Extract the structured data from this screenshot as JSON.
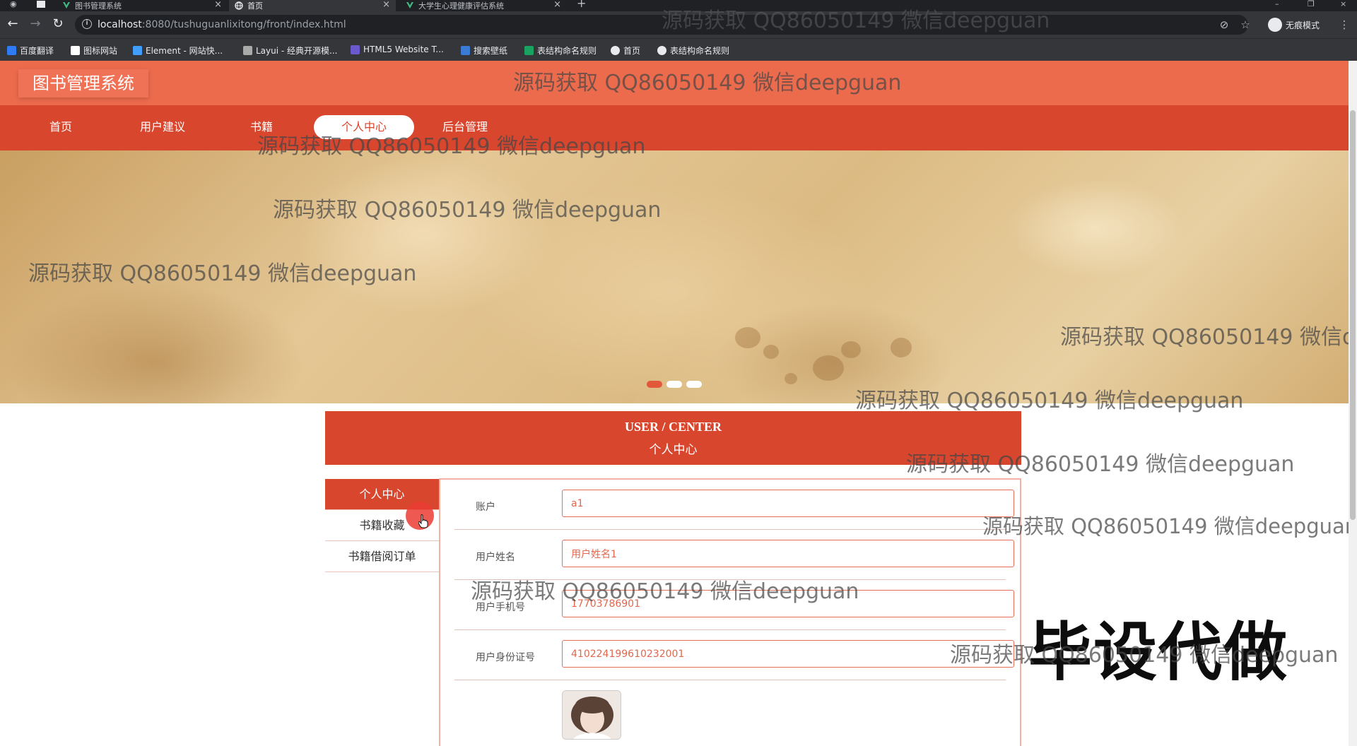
{
  "browser": {
    "tabs": [
      {
        "title": "图书管理系统",
        "icon": "vue-icon",
        "active": false
      },
      {
        "title": "首页",
        "icon": "globe-icon",
        "active": true
      },
      {
        "title": "大学生心理健康评估系统",
        "icon": "vue-icon",
        "active": false
      }
    ],
    "new_tab_label": "+",
    "url_host": "localhost",
    "url_rest": ":8080/tushuguanlixitong/front/index.html",
    "incognito_label": "无痕模式",
    "bookmarks": [
      {
        "label": "百度翻译",
        "icon": "translate-icon",
        "color": "#2f7bf5"
      },
      {
        "label": "图标网站",
        "icon": "flag-icon",
        "color": "#ffffff"
      },
      {
        "label": "Element - 网站快...",
        "icon": "element-icon",
        "color": "#409eff"
      },
      {
        "label": "Layui - 经典开源模...",
        "icon": "layui-icon",
        "color": "#aaaaaa"
      },
      {
        "label": "HTML5 Website T...",
        "icon": "html5-icon",
        "color": "#6a5acd"
      },
      {
        "label": "搜索壁纸",
        "icon": "wallpaper-icon",
        "color": "#3a7bd5"
      },
      {
        "label": "表结构命名规则",
        "icon": "sheet-icon",
        "color": "#1aa260"
      },
      {
        "label": "首页",
        "icon": "globe-icon",
        "color": "#e8eaed"
      },
      {
        "label": "表结构命名规则",
        "icon": "globe-icon",
        "color": "#e8eaed"
      }
    ]
  },
  "site": {
    "logo": "图书管理系统",
    "nav": [
      {
        "label": "首页",
        "active": false
      },
      {
        "label": "用户建议",
        "active": false
      },
      {
        "label": "书籍",
        "active": false
      },
      {
        "label": "个人中心",
        "active": true
      },
      {
        "label": "后台管理",
        "active": false
      }
    ],
    "banner_dots": [
      true,
      false,
      false
    ]
  },
  "user_center": {
    "title_en": "USER / CENTER",
    "title_cn": "个人中心",
    "sidebar": [
      {
        "label": "个人中心",
        "active": true
      },
      {
        "label": "书籍收藏",
        "active": false
      },
      {
        "label": "书籍借阅订单",
        "active": false
      }
    ],
    "fields": [
      {
        "label": "账户",
        "value": "a1"
      },
      {
        "label": "用户姓名",
        "value": "用户姓名1"
      },
      {
        "label": "用户手机号",
        "value": "17703786901"
      },
      {
        "label": "用户身份证号",
        "value": "410224199610232001"
      }
    ]
  },
  "watermarks": {
    "text": "源码获取 QQ86050149 微信deepguan",
    "cropped_text": "源码获取 QQ86050149 微信de",
    "stamp": "毕设代做"
  },
  "colors": {
    "header": "#ed6b4d",
    "navbar": "#d8462e",
    "accent": "#d8462e",
    "input_text": "#e2674e"
  }
}
